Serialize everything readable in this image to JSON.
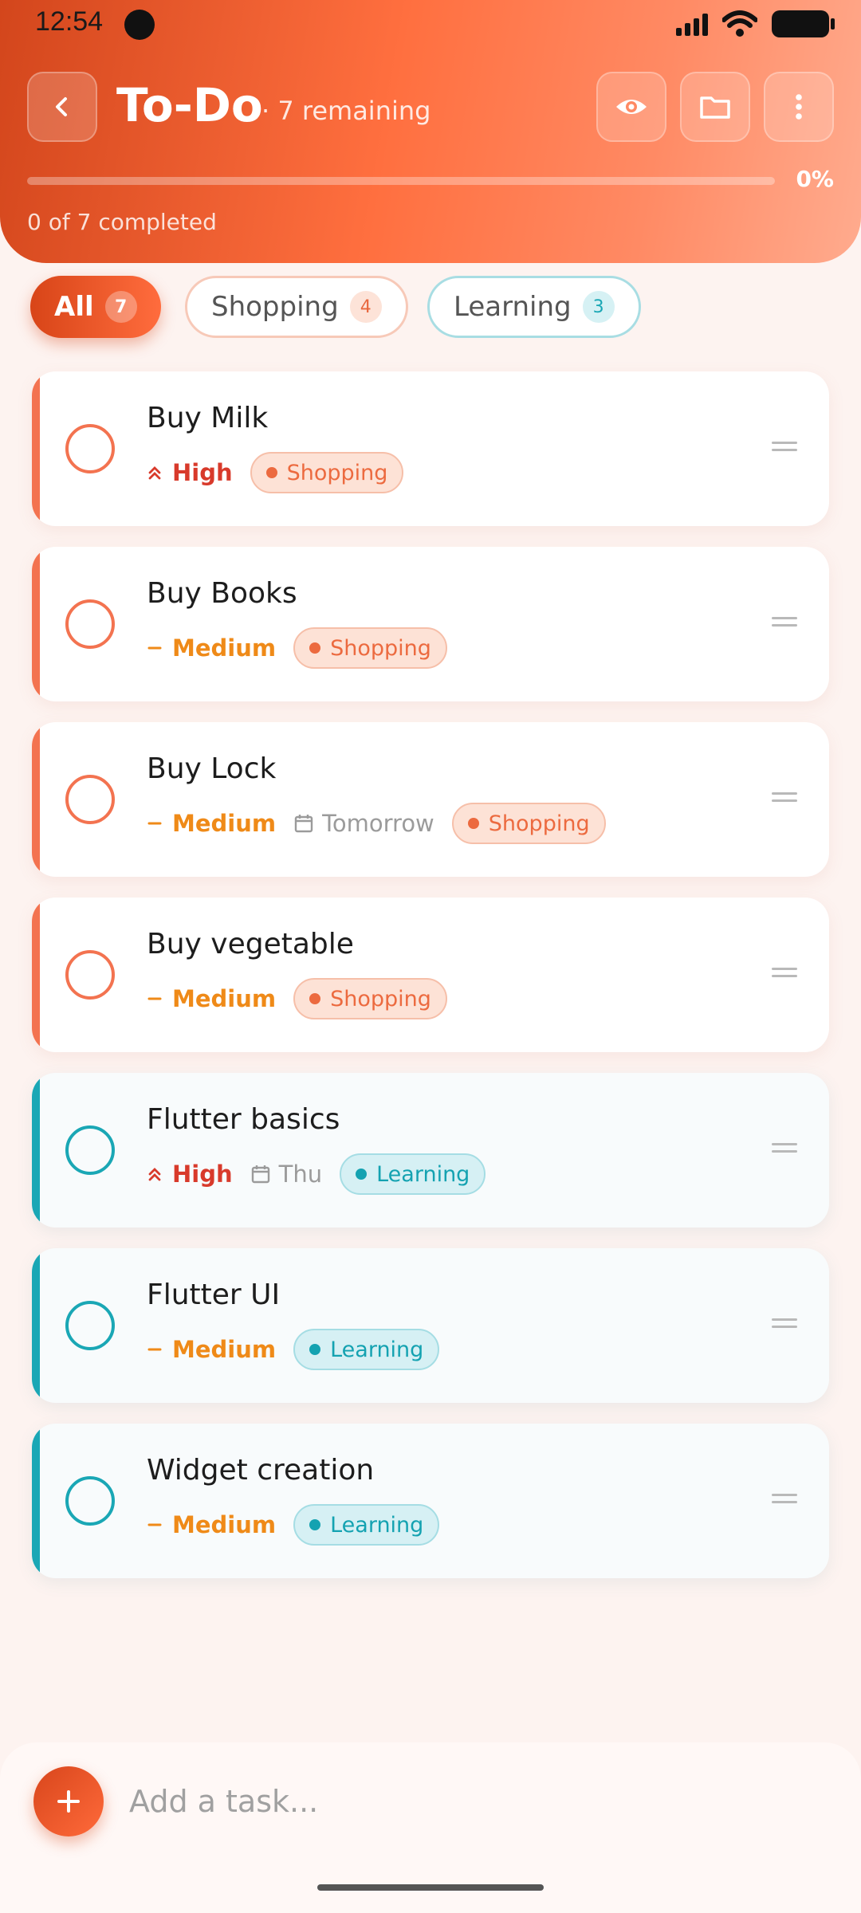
{
  "status_bar": {
    "time": "12:54"
  },
  "header": {
    "title": "To-Do",
    "subtitle": "· 7 remaining",
    "progress_percent": 0,
    "progress_label": "0%",
    "progress_text": "0 of 7 completed"
  },
  "filters": [
    {
      "label": "All",
      "count": "7"
    },
    {
      "label": "Shopping",
      "count": "4"
    },
    {
      "label": "Learning",
      "count": "3"
    }
  ],
  "tasks": [
    {
      "title": "Buy Milk",
      "priority": "High",
      "due": "",
      "tag": "Shopping"
    },
    {
      "title": "Buy Books",
      "priority": "Medium",
      "due": "",
      "tag": "Shopping"
    },
    {
      "title": "Buy Lock",
      "priority": "Medium",
      "due": "Tomorrow",
      "tag": "Shopping"
    },
    {
      "title": "Buy vegetable",
      "priority": "Medium",
      "due": "",
      "tag": "Shopping"
    },
    {
      "title": "Flutter basics",
      "priority": "High",
      "due": "Thu",
      "tag": "Learning"
    },
    {
      "title": "Flutter UI",
      "priority": "Medium",
      "due": "",
      "tag": "Learning"
    },
    {
      "title": "Widget creation",
      "priority": "Medium",
      "due": "",
      "tag": "Learning"
    }
  ],
  "composer": {
    "placeholder": "Add a task..."
  },
  "colors": {
    "accent": "#ff6c3d",
    "shopping": "#f37350",
    "learning": "#1aa7b5",
    "high": "#d83a2b",
    "medium": "#ef8a18"
  },
  "icons": {
    "back": "chevron-left-icon",
    "view": "eye-icon",
    "folder": "folder-icon",
    "menu": "more-vertical-icon",
    "add": "plus-icon",
    "drag": "drag-handle-icon",
    "due": "calendar-icon"
  }
}
